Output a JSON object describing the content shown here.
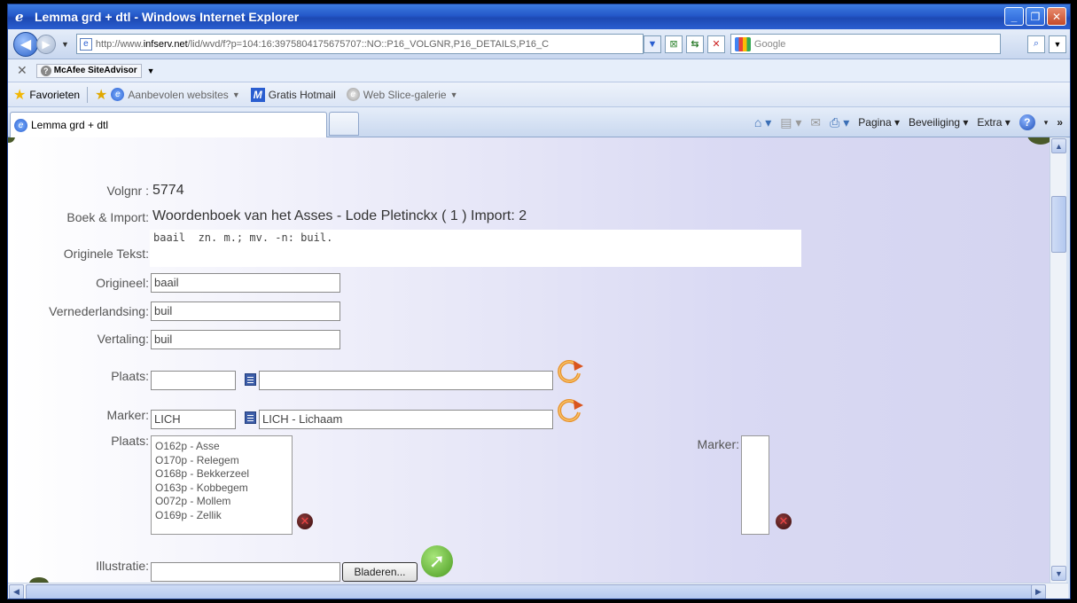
{
  "window": {
    "title": "Lemma grd + dtl - Windows Internet Explorer",
    "minimize": "_",
    "maximize": "❐",
    "close": "✕"
  },
  "address": {
    "url_prefix": "http://www.",
    "url_domain": "infserv.net",
    "url_rest": "/lid/wvd/f?p=104:16:3975804175675707::NO::P16_VOLGNR,P16_DETAILS,P16_C",
    "search_placeholder": "Google"
  },
  "toolbar": {
    "mcafee_label": "McAfee SiteAdvisor"
  },
  "favorites": {
    "favorites_label": "Favorieten",
    "items": [
      "Aanbevolen websites",
      "Gratis Hotmail",
      "Web Slice-galerie"
    ]
  },
  "tab": {
    "label": "Lemma grd + dtl"
  },
  "commandbar": {
    "pagina": "Pagina",
    "beveiliging": "Beveiliging",
    "extra": "Extra"
  },
  "form": {
    "volgnr_label": "Volgnr :",
    "volgnr_value": "5774",
    "boek_label": "Boek & Import:",
    "boek_value": "Woordenboek van het Asses - Lode Pletinckx ( 1 ) Import: 2",
    "originele_label": "Originele Tekst:",
    "originele_value": "baail  zn. m.; mv. -n: buil.",
    "origineel_label": "Origineel:",
    "origineel_value": "baail",
    "vernederlandsing_label": "Vernederlandsing:",
    "vernederlandsing_value": "buil",
    "vertaling_label": "Vertaling:",
    "vertaling_value": "buil",
    "plaats_label": "Plaats:",
    "plaats_code": "",
    "plaats_name": "",
    "marker_label": "Marker:",
    "marker_code": "LICH",
    "marker_name": "LICH - Lichaam",
    "plaats_list_label": "Plaats:",
    "plaats_list": [
      "O162p - Asse",
      "O170p - Relegem",
      "O168p - Bekkerzeel",
      "O163p - Kobbegem",
      "O072p - Mollem",
      "O169p - Zellik"
    ],
    "marker_list_label": "Marker:",
    "illustratie_label": "Illustratie:",
    "bladeren_label": "Bladeren..."
  }
}
